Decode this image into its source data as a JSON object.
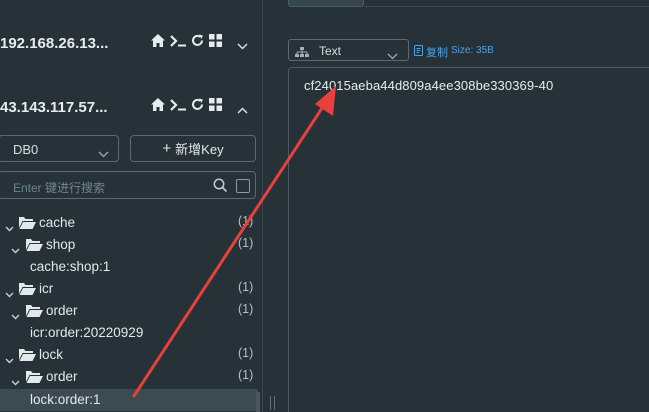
{
  "connections": [
    {
      "name": "192.168.26.13...",
      "expanded": false
    },
    {
      "name": "43.143.117.57...",
      "expanded": true
    }
  ],
  "icons": {
    "home": "home-icon",
    "terminal": "terminal-icon",
    "refresh": "refresh-icon",
    "grid": "grid-icon",
    "chevron_down": "chevron-down-icon",
    "chevron_up": "chevron-up-icon",
    "folder": "folder-open-icon",
    "search": "search-icon",
    "copy": "copy-icon",
    "tree": "tree-icon"
  },
  "toolbar": {
    "db_value": "DB0",
    "add_key_plus": "+",
    "add_key_label": "新增Key",
    "search_placeholder": "Enter 键进行搜索"
  },
  "tree": [
    {
      "label": "cache",
      "count": "(1)",
      "level": 0,
      "type": "folder"
    },
    {
      "label": "shop",
      "count": "(1)",
      "level": 1,
      "type": "folder"
    },
    {
      "label": "cache:shop:1",
      "count": "",
      "level": 2,
      "type": "key"
    },
    {
      "label": "icr",
      "count": "(1)",
      "level": 0,
      "type": "folder"
    },
    {
      "label": "order",
      "count": "(1)",
      "level": 1,
      "type": "folder"
    },
    {
      "label": "icr:order:20220929",
      "count": "",
      "level": 2,
      "type": "key"
    },
    {
      "label": "lock",
      "count": "(1)",
      "level": 0,
      "type": "folder"
    },
    {
      "label": "order",
      "count": "(1)",
      "level": 1,
      "type": "folder"
    },
    {
      "label": "lock:order:1",
      "count": "",
      "level": 2,
      "type": "key",
      "selected": true
    }
  ],
  "detail": {
    "format": "Text",
    "copy_label": "复制",
    "size_label": "Size: 35B",
    "value": "cf24015aeba44d809a4ee308be330369-40"
  },
  "colors": {
    "background": "#263238",
    "accent": "#4aa3e8",
    "arrow": "#e8403a",
    "selected_row": "#3c4a52"
  }
}
